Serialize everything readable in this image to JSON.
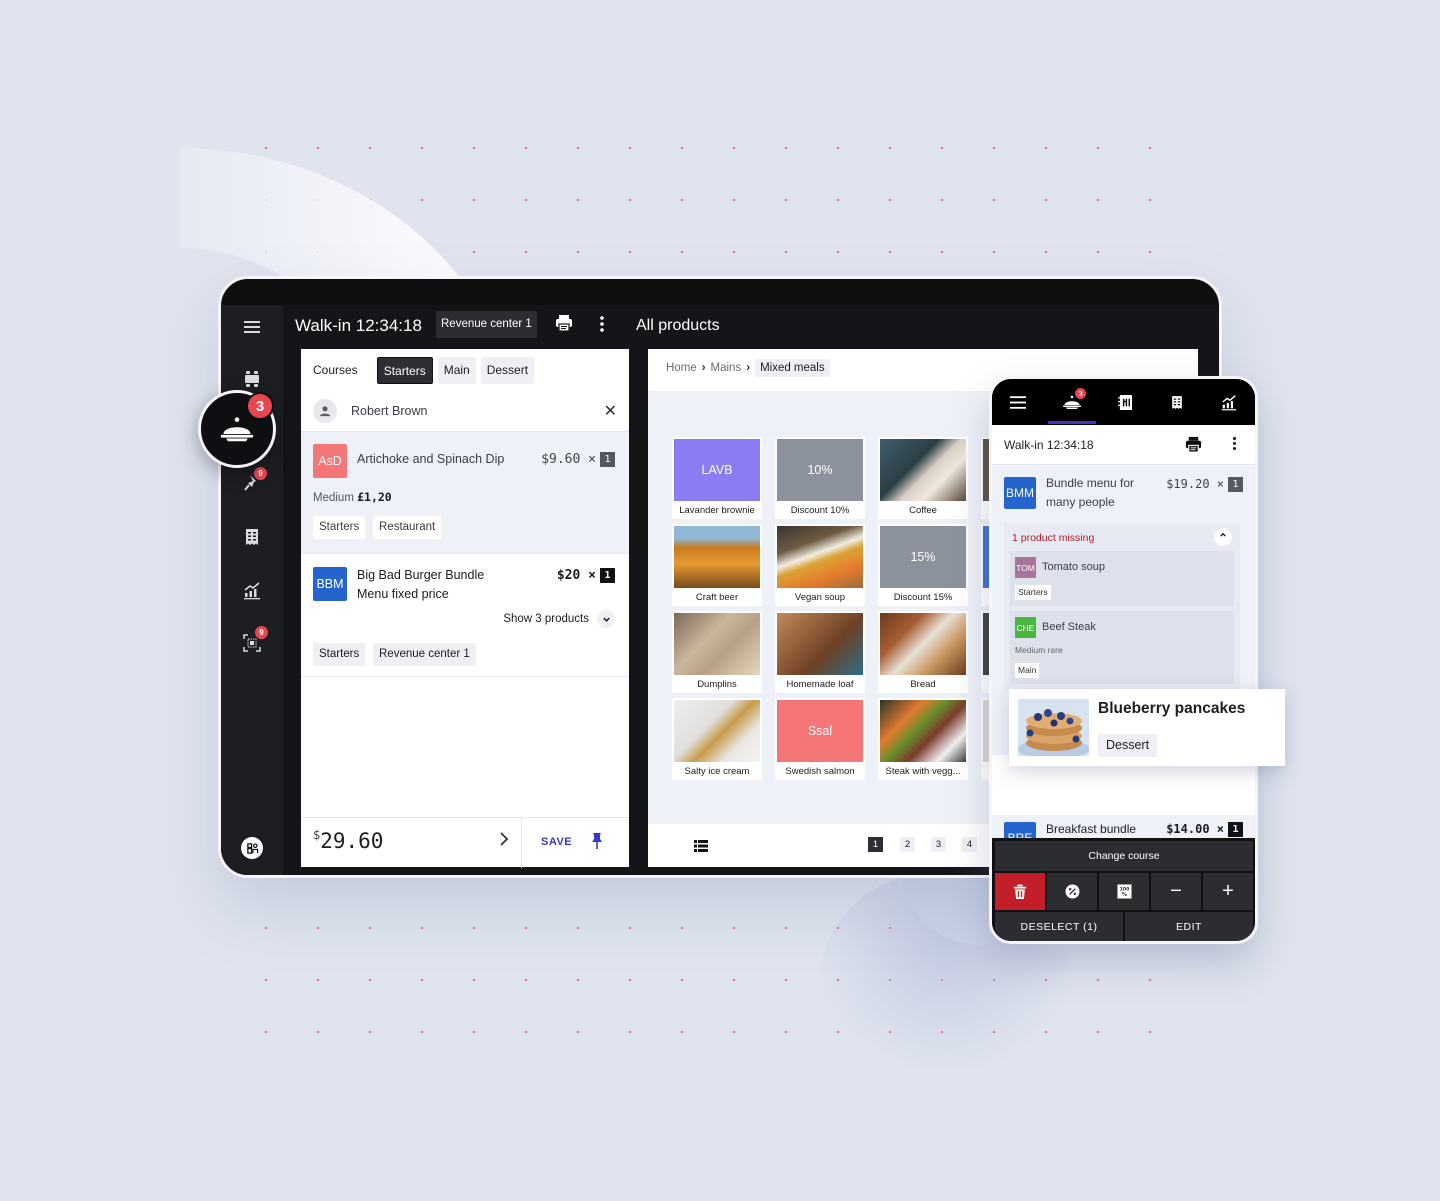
{
  "tablet": {
    "order_title": "Walk-in 12:34:18",
    "revenue_center": "Revenue center 1",
    "products_title": "All products",
    "sidebar": {
      "items": [
        {
          "icon": "tables-icon"
        },
        {
          "icon": "order-cloche-icon",
          "badge": "3"
        },
        {
          "icon": "pin-icon",
          "badge": "9"
        },
        {
          "icon": "receipt-icon"
        },
        {
          "icon": "analytics-icon"
        },
        {
          "icon": "qr-scan-icon",
          "badge": "9"
        },
        {
          "icon": "user-logo-icon"
        }
      ]
    },
    "floating_badge": "3",
    "order": {
      "course_label": "Courses",
      "courses": [
        {
          "label": "Starters",
          "active": true
        },
        {
          "label": "Main",
          "active": false
        },
        {
          "label": "Dessert",
          "active": false
        }
      ],
      "customer": "Robert Brown",
      "items": [
        {
          "abbr": "AsD",
          "color": "#f47677",
          "name": "Artichoke and Spinach Dip",
          "price": "$9.60 ×",
          "qty": "1",
          "modifier_label": "Medium",
          "modifier_price": "£1,20",
          "tags": [
            "Starters",
            "Restaurant"
          ]
        },
        {
          "abbr": "BBM",
          "color": "#2464cc",
          "name_line1": "Big Bad Burger Bundle",
          "name_line2": "Menu fixed price",
          "price": "$20 ×",
          "qty": "1",
          "show_products": "Show 3 products",
          "tags": [
            "Starters",
            "Revenue center 1"
          ]
        }
      ],
      "total_currency": "$",
      "total": "29.60",
      "save_label": "SAVE"
    },
    "breadcrumb": [
      "Home",
      "Mains",
      "Mixed meals"
    ],
    "products": [
      {
        "label": "Lavander brownie",
        "abbr": "LAVB",
        "color": "#8a7cf3"
      },
      {
        "label": "Discount 10%",
        "abbr": "10%",
        "color": "#8c929d"
      },
      {
        "label": "Coffee",
        "image": "coffee"
      },
      {
        "label": "Craft beer",
        "image": "beer"
      },
      {
        "label": "Vegan soup",
        "image": "soup"
      },
      {
        "label": "Discount 15%",
        "abbr": "15%",
        "color": "#8c929d"
      },
      {
        "label": "Dumplins",
        "image": "dumplings"
      },
      {
        "label": "Homemade loaf",
        "image": "loaf"
      },
      {
        "label": "Bread",
        "image": "bread"
      },
      {
        "label": "Salty ice cream",
        "image": "icecream"
      },
      {
        "label": "Swedish salmon",
        "abbr": "Ssal",
        "color": "#f47677"
      },
      {
        "label": "Steak with vegg...",
        "image": "steak"
      }
    ],
    "pages": [
      "1",
      "2",
      "3",
      "4"
    ],
    "current_page": "1"
  },
  "phone": {
    "nav_badge": "3",
    "title": "Walk-in 12:34:18",
    "bundle": {
      "abbr": "BMM",
      "color": "#2464cc",
      "name_line1": "Bundle menu for",
      "name_line2": "many people",
      "price": "$19.20 ×",
      "qty": "1",
      "missing_label": "1 product missing",
      "sub_items": [
        {
          "abbr": "TOM",
          "color": "#a9739a",
          "name": "Tomato soup",
          "tag": "Starters"
        },
        {
          "abbr": "CHE",
          "color": "#4bb543",
          "name": "Beef Steak",
          "modifier": "Medium rare",
          "tag": "Main"
        }
      ]
    },
    "popup": {
      "title": "Blueberry pancakes",
      "tag": "Dessert"
    },
    "breakfast": {
      "abbr": "BRE",
      "color": "#2464cc",
      "name": "Breakfast bundle",
      "price": "$14.00 ×",
      "qty": "1"
    },
    "actions": {
      "change_course": "Change course",
      "deselect": "DESELECT (1)",
      "edit": "EDIT"
    }
  }
}
